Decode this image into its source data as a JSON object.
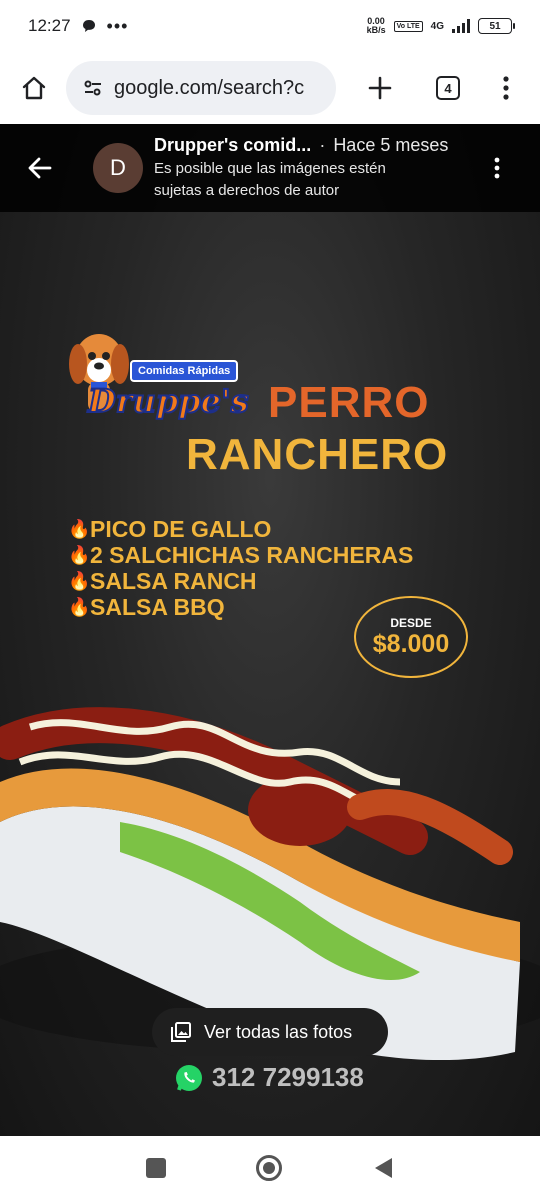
{
  "status_bar": {
    "time": "12:27",
    "net_speed_value": "0.00",
    "net_speed_unit": "kB/s",
    "volte": "Vo LTE",
    "network": "4G",
    "battery": "51",
    "icons": [
      "chat-bubble-icon",
      "more-dots-icon",
      "signal-icon",
      "battery-icon"
    ]
  },
  "browser": {
    "url": "google.com/search?c",
    "tab_count": "4",
    "icons": [
      "home-icon",
      "site-settings-icon",
      "new-tab-icon",
      "tab-switcher-icon",
      "menu-icon"
    ]
  },
  "image_viewer": {
    "avatar_letter": "D",
    "source": "Drupper's comid...",
    "separator": "·",
    "time_ago": "Hace 5 meses",
    "copyright_line1": "Es posible que las imágenes estén",
    "copyright_line2": "sujetas a derechos de autor",
    "all_photos_button": "Ver todas las fotos"
  },
  "promo": {
    "brand_tagline": "Comidas Rápidas",
    "brand_name": "Druppe's",
    "title_line1": "PERRO",
    "title_line2": "RANCHERO",
    "ingredients": [
      "PICO DE GALLO",
      "2 SALCHICHAS RANCHERAS",
      "SALSA RANCH",
      "SALSA BBQ"
    ],
    "price_label": "DESDE",
    "price": "$8.000",
    "phone": "312 7299138"
  },
  "colors": {
    "accent_orange": "#e4662a",
    "accent_yellow": "#f1b53c",
    "whatsapp_green": "#25d366",
    "viewer_bg": "#262626"
  }
}
